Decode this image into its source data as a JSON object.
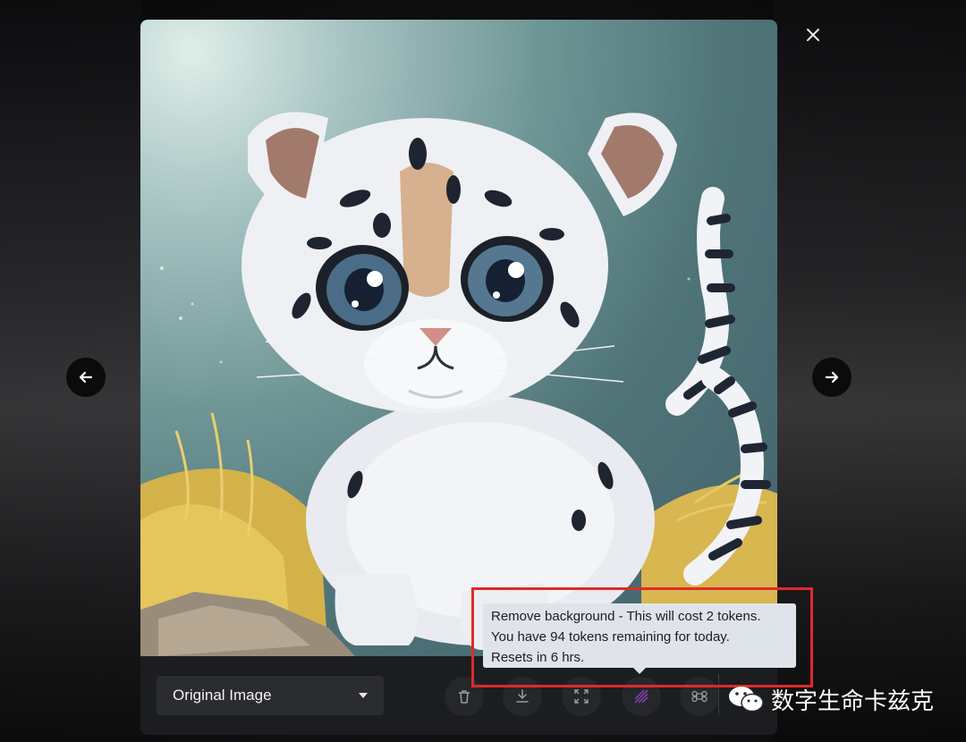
{
  "viewer": {
    "close_icon": "close-icon",
    "prev_icon": "arrow-left-icon",
    "next_icon": "arrow-right-icon"
  },
  "image": {
    "subject": "kitten-illustration"
  },
  "toolbar": {
    "view_select_value": "Original Image",
    "tools": [
      {
        "name": "delete",
        "icon": "trash-icon"
      },
      {
        "name": "download",
        "icon": "download-icon"
      },
      {
        "name": "upscale",
        "icon": "expand-icon"
      },
      {
        "name": "remove-background",
        "icon": "remove-background-icon"
      },
      {
        "name": "command",
        "icon": "command-icon"
      }
    ]
  },
  "tooltip": {
    "line1": "Remove background - This will cost 2 tokens.",
    "line2": "You have 94 tokens remaining for today.",
    "line3": "Resets in 6 hrs."
  },
  "watermark": {
    "text": "数字生命卡兹克",
    "icon": "wechat-icon"
  },
  "colors": {
    "highlight": "#e02a2a",
    "tooltip_bg": "#dfe3ea",
    "toolbar_bg": "#1c1d20"
  }
}
